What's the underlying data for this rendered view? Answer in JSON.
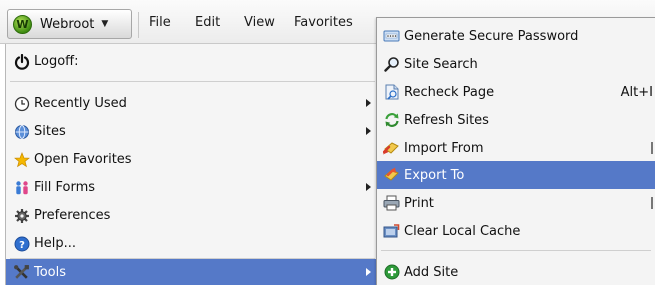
{
  "menubar": {
    "app_button": {
      "logo_letter": "W",
      "label": "Webroot"
    },
    "items": [
      "File",
      "Edit",
      "View",
      "Favorites"
    ]
  },
  "left_menu": {
    "logoff": "Logoff:",
    "items": [
      {
        "label": "Recently Used",
        "icon": "clock-icon",
        "has_submenu": true
      },
      {
        "label": "Sites",
        "icon": "globe-icon",
        "has_submenu": true
      },
      {
        "label": "Open Favorites",
        "icon": "star-icon",
        "has_submenu": false
      },
      {
        "label": "Fill Forms",
        "icon": "people-icon",
        "has_submenu": true
      },
      {
        "label": "Preferences",
        "icon": "gear-icon",
        "has_submenu": false
      },
      {
        "label": "Help...",
        "icon": "help-icon",
        "has_submenu": false
      },
      {
        "label": "Tools",
        "icon": "tools-icon",
        "has_submenu": true,
        "selected": true
      }
    ]
  },
  "tools_submenu": {
    "items": [
      {
        "label": "Generate Secure Password",
        "icon": "password-generator-icon"
      },
      {
        "label": "Site Search",
        "icon": "magnifier-icon"
      },
      {
        "label": "Recheck Page",
        "icon": "recheck-page-icon",
        "shortcut": "Alt+I"
      },
      {
        "label": "Refresh Sites",
        "icon": "refresh-icon"
      },
      {
        "label": "Import From",
        "icon": "import-icon"
      },
      {
        "label": "Export To",
        "icon": "export-icon",
        "selected": true
      },
      {
        "label": "Print",
        "icon": "printer-icon"
      },
      {
        "label": "Clear Local Cache",
        "icon": "clear-cache-icon"
      },
      {
        "label": "Add Site",
        "icon": "add-site-icon"
      }
    ]
  },
  "colors": {
    "selection": "#5579c8",
    "menu_bg": "#f5f5f5",
    "brand_green": "#3f8c12"
  }
}
